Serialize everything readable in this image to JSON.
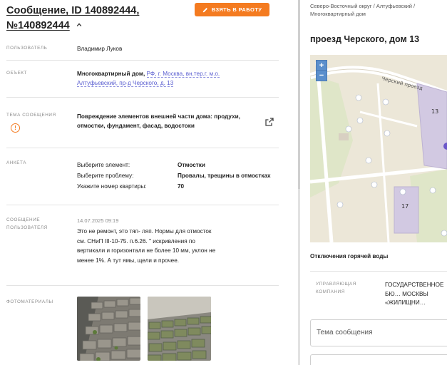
{
  "header": {
    "title": "Сообщение, ID 140892444, №140892444",
    "take_button": "ВЗЯТЬ В РАБОТУ"
  },
  "fields": {
    "user_label": "ПОЛЬЗОВАТЕЛЬ",
    "user_value": "Владимир Луков",
    "object_label": "ОБЪЕКТ",
    "object_type": "Многоквартирный дом,",
    "object_address": "РФ, г. Москва, вн.тер.г. м.о. Алтуфьевский, пр-д Черского, д. 13",
    "topic_label": "ТЕМА СООБЩЕНИЯ",
    "topic_value": "Повреждение элементов внешней части дома: продухи, отмостки, фундамент, фасад, водостоки",
    "survey_label": "АНКЕТА",
    "survey": [
      {
        "key": "Выберите элемент:",
        "value": "Отмостки"
      },
      {
        "key": "Выберите проблему:",
        "value": "Провалы, трещины в отмостках"
      },
      {
        "key": "Укажите номер квартиры:",
        "value": "70"
      }
    ],
    "message_label": "СООБЩЕНИЕ ПОЛЬЗОВАТЕЛЯ",
    "message_date": "14.07.2025 09:19",
    "message_text": "Это не ремонт, это тяп- ляп. Нормы для отмосток см. СНиП III-10-75. п.6.26. \" искривления по вертикали и горизонтали не более 10 мм, уклон не менее 1%. А тут ямы, щели и прочее.",
    "photos_label": "ФОТОМАТЕРИАЛЫ"
  },
  "right": {
    "breadcrumbs": "Северо-Восточный округ / Алтуфьевский / Многоквартирный дом",
    "address": "проезд Черского, дом 13",
    "map": {
      "street_label": "Черский проезд",
      "house_13": "13",
      "house_17": "17",
      "zoom_in": "+",
      "zoom_out": "−"
    },
    "hot_water_title": "Отключения горячей воды",
    "mc_label": "УПРАВЛЯЮЩАЯ КОМПАНИЯ",
    "mc_value": "ГОСУДАРСТВЕННОЕ БЮ… МОСКВЫ «ЖИЛИЩНИ…",
    "subject_placeholder": "Тема сообщения"
  },
  "colors": {
    "accent": "#f47b20",
    "link": "#5a5ed0",
    "map_bg": "#ece7d8"
  }
}
